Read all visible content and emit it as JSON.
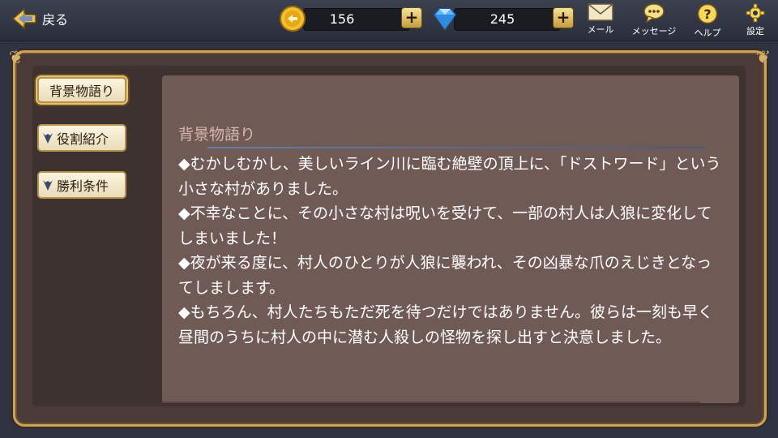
{
  "header": {
    "back_label": "戻る",
    "back_icon": "back-arrow-icon",
    "coins": {
      "value": "156",
      "icon": "coin-icon"
    },
    "gems": {
      "value": "245",
      "icon": "gem-icon"
    },
    "plus_label": "+",
    "icons": [
      {
        "name": "mail-icon",
        "label": "メール"
      },
      {
        "name": "message-icon",
        "label": "メッセージ"
      },
      {
        "name": "help-icon",
        "label": "ヘルプ"
      },
      {
        "name": "settings-icon",
        "label": "設定"
      }
    ]
  },
  "sidebar": {
    "tabs": [
      {
        "label": "背景物語り",
        "active": true
      },
      {
        "label": "役割紹介",
        "active": false
      },
      {
        "label": "勝利条件",
        "active": false
      }
    ]
  },
  "content": {
    "title": "背景物語り",
    "paragraphs": [
      "◆むかしむかし、美しいライン川に臨む絶壁の頂上に、「ドストワード」という小さな村がありました。",
      "◆不幸なことに、その小さな村は呪いを受けて、一部の村人は人狼に変化してしまいました！",
      "◆夜が来る度に、村人のひとりが人狼に襲われ、その凶暴な爪のえじきとなってしまします。",
      "◆もちろん、村人たちもただ死を待つだけではありません。彼らは一刻も早く昼間のうちに村人の中に潜む人殺しの怪物を探し出すと決意しました。"
    ]
  },
  "colors": {
    "accent_gold": "#caa35c",
    "panel": "#705a56",
    "topbar": "#2f3341"
  }
}
